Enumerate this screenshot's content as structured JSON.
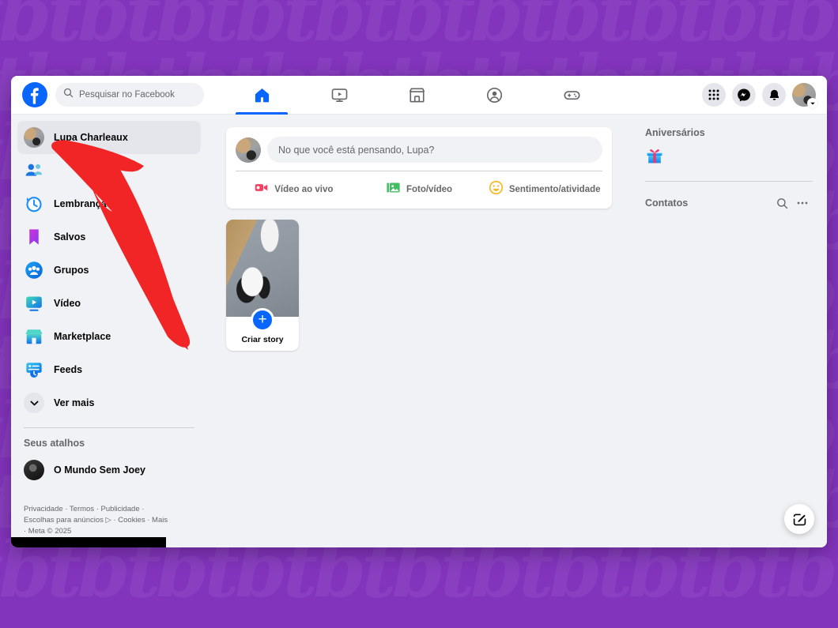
{
  "backdrop": {
    "color": "#8334bd",
    "watermark_text": "tbtbtbtbtbtbtbtbtbtbtbtbtbtbtbtbtbtbtbtbtb"
  },
  "topbar": {
    "logo_icon": "facebook-logo-icon",
    "search": {
      "icon": "search-icon",
      "placeholder": "Pesquisar no Facebook",
      "value": ""
    },
    "tabs": [
      {
        "name": "home",
        "icon": "home-icon",
        "active": true
      },
      {
        "name": "video",
        "icon": "video-monitor-icon",
        "active": false
      },
      {
        "name": "marketplace",
        "icon": "storefront-icon",
        "active": false
      },
      {
        "name": "groups",
        "icon": "groups-people-icon",
        "active": false
      },
      {
        "name": "gaming",
        "icon": "gamepad-icon",
        "active": false
      }
    ],
    "right_actions": [
      {
        "name": "menu-grid",
        "icon": "grid-apps-icon"
      },
      {
        "name": "messenger",
        "icon": "messenger-icon"
      },
      {
        "name": "notifications",
        "icon": "bell-icon"
      },
      {
        "name": "account",
        "icon": "account-avatar-icon"
      }
    ],
    "accent_color": "#0866ff"
  },
  "sidebar": {
    "items": [
      {
        "label": "Lupa Charleaux",
        "icon": "profile-avatar-icon",
        "active": true
      },
      {
        "label": "",
        "icon": "friends-icon",
        "active": false
      },
      {
        "label": "Lembranças",
        "icon": "memories-clock-icon",
        "active": false
      },
      {
        "label": "Salvos",
        "icon": "saved-bookmark-icon",
        "active": false
      },
      {
        "label": "Grupos",
        "icon": "groups-icon",
        "active": false
      },
      {
        "label": "Vídeo",
        "icon": "video-icon",
        "active": false
      },
      {
        "label": "Marketplace",
        "icon": "marketplace-icon",
        "active": false
      },
      {
        "label": "Feeds",
        "icon": "feeds-icon",
        "active": false
      },
      {
        "label": "Ver mais",
        "icon": "chevron-down-icon",
        "active": false
      }
    ],
    "shortcuts_title": "Seus atalhos",
    "shortcuts": [
      {
        "label": "O Mundo Sem Joey",
        "icon": "page-avatar-icon"
      }
    ],
    "footer": {
      "line1": "Privacidade · Termos · Publicidade ·",
      "line2": "Escolhas para anúncios",
      "line2b": "· Cookies · Mais",
      "line3": "· Meta © 2025",
      "adchoices_icon": "adchoices-icon"
    }
  },
  "composer": {
    "avatar_icon": "composer-avatar-icon",
    "placeholder": "No que você está pensando, Lupa?",
    "actions": [
      {
        "label": "Vídeo ao vivo",
        "icon": "live-video-icon",
        "color": "#f3425f"
      },
      {
        "label": "Foto/vídeo",
        "icon": "photo-video-icon",
        "color": "#45bd62"
      },
      {
        "label": "Sentimento/atividade",
        "icon": "feeling-activity-icon",
        "color": "#f7b928"
      }
    ]
  },
  "stories": {
    "create": {
      "label": "Criar story",
      "plus_icon": "plus-icon",
      "thumb_icon": "cat-photo-thumb"
    }
  },
  "rightbar": {
    "birthdays_title": "Aniversários",
    "birthdays_icon": "gift-icon",
    "contacts_title": "Contatos",
    "contacts_actions": [
      {
        "name": "contacts-search",
        "icon": "search-icon"
      },
      {
        "name": "contacts-options",
        "icon": "ellipsis-icon"
      }
    ]
  },
  "fab": {
    "name": "new-message",
    "icon": "compose-pencil-icon"
  },
  "annotation": {
    "type": "arrow",
    "color": "#ff2222",
    "points_to": "Lupa Charleaux"
  }
}
